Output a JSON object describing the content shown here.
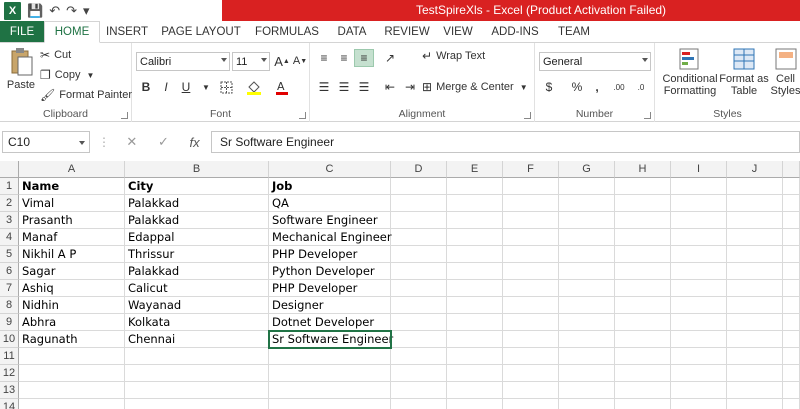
{
  "window": {
    "title": "TestSpireXls - Excel (Product Activation Failed)"
  },
  "qat": {
    "logo": "X",
    "save": "💾",
    "undo": "↶",
    "redo": "↷",
    "customize": "▾"
  },
  "tabs": [
    "FILE",
    "HOME",
    "INSERT",
    "PAGE LAYOUT",
    "FORMULAS",
    "DATA",
    "REVIEW",
    "VIEW",
    "ADD-INS",
    "TEAM"
  ],
  "active_tab": "HOME",
  "ribbon": {
    "clipboard": {
      "label": "Clipboard",
      "paste": "Paste",
      "cut": "Cut",
      "copy": "Copy",
      "format_painter": "Format Painter"
    },
    "font": {
      "label": "Font",
      "name": "Calibri",
      "size": "11",
      "grow": "A",
      "shrink": "A",
      "bold": "B",
      "italic": "I",
      "underline": "U"
    },
    "alignment": {
      "label": "Alignment",
      "wrap_text": "Wrap Text",
      "merge_center": "Merge & Center"
    },
    "number": {
      "label": "Number",
      "format": "General",
      "currency": "$",
      "percent": "%",
      "comma": ",",
      "inc_dec": ".00",
      "dec_dec": ".0"
    },
    "styles": {
      "label": "Styles",
      "conditional": "Conditional",
      "conditional2": "Formatting",
      "format_as": "Format as",
      "table": "Table",
      "cell": "Cell",
      "cell_styles": "Styles"
    }
  },
  "formula_bar": {
    "name_box": "C10",
    "fx": "fx",
    "cancel": "✕",
    "enter": "✓",
    "content": "Sr Software Engineer"
  },
  "columns": [
    "A",
    "B",
    "C",
    "D",
    "E",
    "F",
    "G",
    "H",
    "I",
    "J"
  ],
  "rows": [
    "1",
    "2",
    "3",
    "4",
    "5",
    "6",
    "7",
    "8",
    "9",
    "10",
    "11",
    "12",
    "13",
    "14"
  ],
  "sheet": [
    [
      "Name",
      "City",
      "Job"
    ],
    [
      "Vimal",
      "Palakkad",
      "QA"
    ],
    [
      "Prasanth",
      "Palakkad",
      "Software Engineer"
    ],
    [
      "Manaf",
      "Edappal",
      "Mechanical Engineer"
    ],
    [
      "Nikhil A P",
      "Thrissur",
      "PHP Developer"
    ],
    [
      "Sagar",
      "Palakkad",
      "Python Developer"
    ],
    [
      "Ashiq",
      "Calicut",
      "PHP Developer"
    ],
    [
      "Nidhin",
      "Wayanad",
      "Designer"
    ],
    [
      "Abhra",
      "Kolkata",
      "Dotnet Developer"
    ],
    [
      "Ragunath",
      "Chennai",
      "Sr Software Engineer"
    ]
  ],
  "colors": {
    "excel_green": "#1f7244",
    "title_red": "#d92121",
    "selection": "#217346"
  }
}
